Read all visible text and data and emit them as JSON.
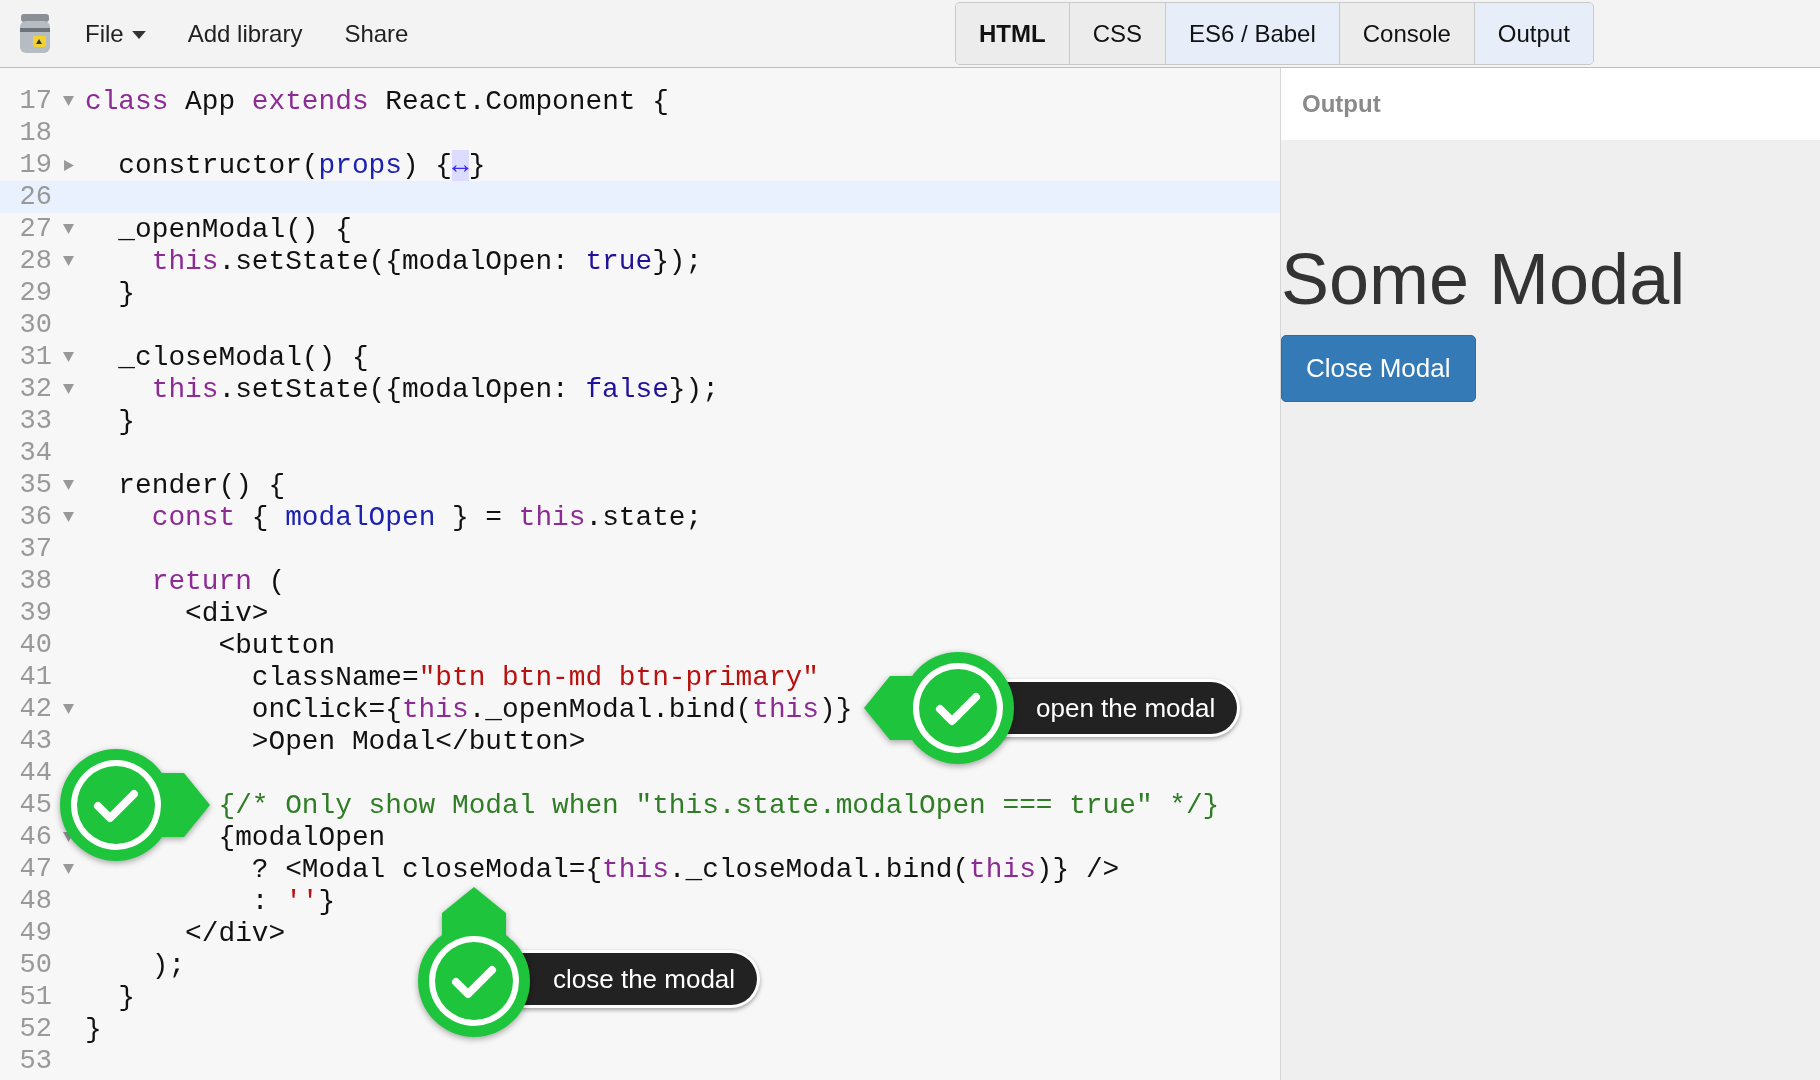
{
  "menu": [
    {
      "label": "File",
      "kind": "dropdown"
    },
    {
      "label": "Add library",
      "kind": "plain"
    },
    {
      "label": "Share",
      "kind": "plain"
    }
  ],
  "panel_tabs": [
    {
      "label": "HTML",
      "selected": false,
      "focused": true
    },
    {
      "label": "CSS",
      "selected": false,
      "focused": false
    },
    {
      "label": "ES6 / Babel",
      "selected": true,
      "focused": false
    },
    {
      "label": "Console",
      "selected": false,
      "focused": false
    },
    {
      "label": "Output",
      "selected": true,
      "focused": false
    }
  ],
  "editor": {
    "lines": [
      {
        "number": "17",
        "collapsed": false,
        "highlighted": false,
        "tokens": [
          {
            "kind": "keyword",
            "text": "class"
          },
          {
            "kind": "plain",
            "text": " App "
          },
          {
            "kind": "keyword",
            "text": "extends"
          },
          {
            "kind": "plain",
            "text": " React.Component {"
          }
        ]
      },
      {
        "number": "18",
        "highlighted": false
      },
      {
        "number": "19",
        "collapsed": true,
        "highlighted": false,
        "tokens": [
          {
            "kind": "plain",
            "text": "  constructor("
          },
          {
            "kind": "variable",
            "text": "props"
          },
          {
            "kind": "plain",
            "text": ") {"
          },
          {
            "kind": "marker",
            "text": "↔"
          },
          {
            "kind": "plain",
            "text": "}"
          }
        ]
      },
      {
        "number": "26",
        "highlighted": true
      },
      {
        "number": "27",
        "collapsed": false,
        "highlighted": false,
        "tokens": [
          {
            "kind": "plain",
            "text": "  _openModal() {"
          }
        ]
      },
      {
        "number": "28",
        "collapsed": false,
        "highlighted": false,
        "tokens": [
          {
            "kind": "keyword",
            "text": "    this"
          },
          {
            "kind": "plain",
            "text": ".setState({modalOpen: "
          },
          {
            "kind": "atom",
            "text": "true"
          },
          {
            "kind": "plain",
            "text": "});"
          }
        ]
      },
      {
        "number": "29",
        "highlighted": false,
        "tokens": [
          {
            "kind": "plain",
            "text": "  }"
          }
        ]
      },
      {
        "number": "30",
        "highlighted": false
      },
      {
        "number": "31",
        "collapsed": false,
        "highlighted": false,
        "tokens": [
          {
            "kind": "plain",
            "text": "  _closeModal() {"
          }
        ]
      },
      {
        "number": "32",
        "collapsed": false,
        "highlighted": false,
        "tokens": [
          {
            "kind": "keyword",
            "text": "    this"
          },
          {
            "kind": "plain",
            "text": ".setState({modalOpen: "
          },
          {
            "kind": "atom",
            "text": "false"
          },
          {
            "kind": "plain",
            "text": "});"
          }
        ]
      },
      {
        "number": "33",
        "highlighted": false,
        "tokens": [
          {
            "kind": "plain",
            "text": "  }"
          }
        ]
      },
      {
        "number": "34",
        "highlighted": false
      },
      {
        "number": "35",
        "collapsed": false,
        "highlighted": false,
        "tokens": [
          {
            "kind": "plain",
            "text": "  render() {"
          }
        ]
      },
      {
        "number": "36",
        "collapsed": false,
        "highlighted": false,
        "tokens": [
          {
            "kind": "keyword",
            "text": "    const"
          },
          {
            "kind": "plain",
            "text": " { "
          },
          {
            "kind": "variable",
            "text": "modalOpen"
          },
          {
            "kind": "plain",
            "text": " } = "
          },
          {
            "kind": "keyword",
            "text": "this"
          },
          {
            "kind": "plain",
            "text": ".state;"
          }
        ]
      },
      {
        "number": "37",
        "highlighted": false
      },
      {
        "number": "38",
        "highlighted": false,
        "tokens": [
          {
            "kind": "keyword",
            "text": "    return"
          },
          {
            "kind": "plain",
            "text": " ("
          }
        ]
      },
      {
        "number": "39",
        "highlighted": false,
        "tokens": [
          {
            "kind": "plain",
            "text": "      <div>"
          }
        ]
      },
      {
        "number": "40",
        "highlighted": false,
        "tokens": [
          {
            "kind": "plain",
            "text": "        <button"
          }
        ]
      },
      {
        "number": "41",
        "highlighted": false,
        "tokens": [
          {
            "kind": "plain",
            "text": "          className="
          },
          {
            "kind": "string",
            "text": "\"btn btn-md btn-primary\""
          }
        ]
      },
      {
        "number": "42",
        "collapsed": false,
        "highlighted": false,
        "tokens": [
          {
            "kind": "plain",
            "text": "          onClick={"
          },
          {
            "kind": "keyword",
            "text": "this"
          },
          {
            "kind": "plain",
            "text": "._openModal.bind("
          },
          {
            "kind": "keyword",
            "text": "this"
          },
          {
            "kind": "plain",
            "text": ")}"
          }
        ]
      },
      {
        "number": "43",
        "highlighted": false,
        "tokens": [
          {
            "kind": "plain",
            "text": "          >Open Modal</button>"
          }
        ]
      },
      {
        "number": "44",
        "highlighted": false
      },
      {
        "number": "45",
        "highlighted": false,
        "tokens": [
          {
            "kind": "comment",
            "text": "        {/* Only show Modal when \"this.state.modalOpen === true\" */}"
          }
        ]
      },
      {
        "number": "46",
        "collapsed": false,
        "highlighted": false,
        "tokens": [
          {
            "kind": "plain",
            "text": "        {modalOpen"
          }
        ]
      },
      {
        "number": "47",
        "collapsed": false,
        "highlighted": false,
        "tokens": [
          {
            "kind": "plain",
            "text": "          ? <Modal closeModal={"
          },
          {
            "kind": "keyword",
            "text": "this"
          },
          {
            "kind": "plain",
            "text": "._closeModal.bind("
          },
          {
            "kind": "keyword",
            "text": "this"
          },
          {
            "kind": "plain",
            "text": ")} />"
          }
        ]
      },
      {
        "number": "48",
        "highlighted": false,
        "tokens": [
          {
            "kind": "plain",
            "text": "          : "
          },
          {
            "kind": "string",
            "text": "''"
          },
          {
            "kind": "plain",
            "text": "}"
          }
        ]
      },
      {
        "number": "49",
        "highlighted": false,
        "tokens": [
          {
            "kind": "plain",
            "text": "      </div>"
          }
        ]
      },
      {
        "number": "50",
        "highlighted": false,
        "tokens": [
          {
            "kind": "plain",
            "text": "    );"
          }
        ]
      },
      {
        "number": "51",
        "highlighted": false,
        "tokens": [
          {
            "kind": "plain",
            "text": "  }"
          }
        ]
      },
      {
        "number": "52",
        "highlighted": false,
        "tokens": [
          {
            "kind": "plain",
            "text": "}"
          }
        ]
      },
      {
        "number": "53",
        "highlighted": false
      }
    ]
  },
  "callouts": [
    {
      "kind": "left",
      "label": "open the modal"
    },
    {
      "kind": "right"
    },
    {
      "kind": "up",
      "label": "close the modal"
    }
  ],
  "output": {
    "header": "Output",
    "heading": "Some Modal",
    "button": "Close Modal"
  }
}
